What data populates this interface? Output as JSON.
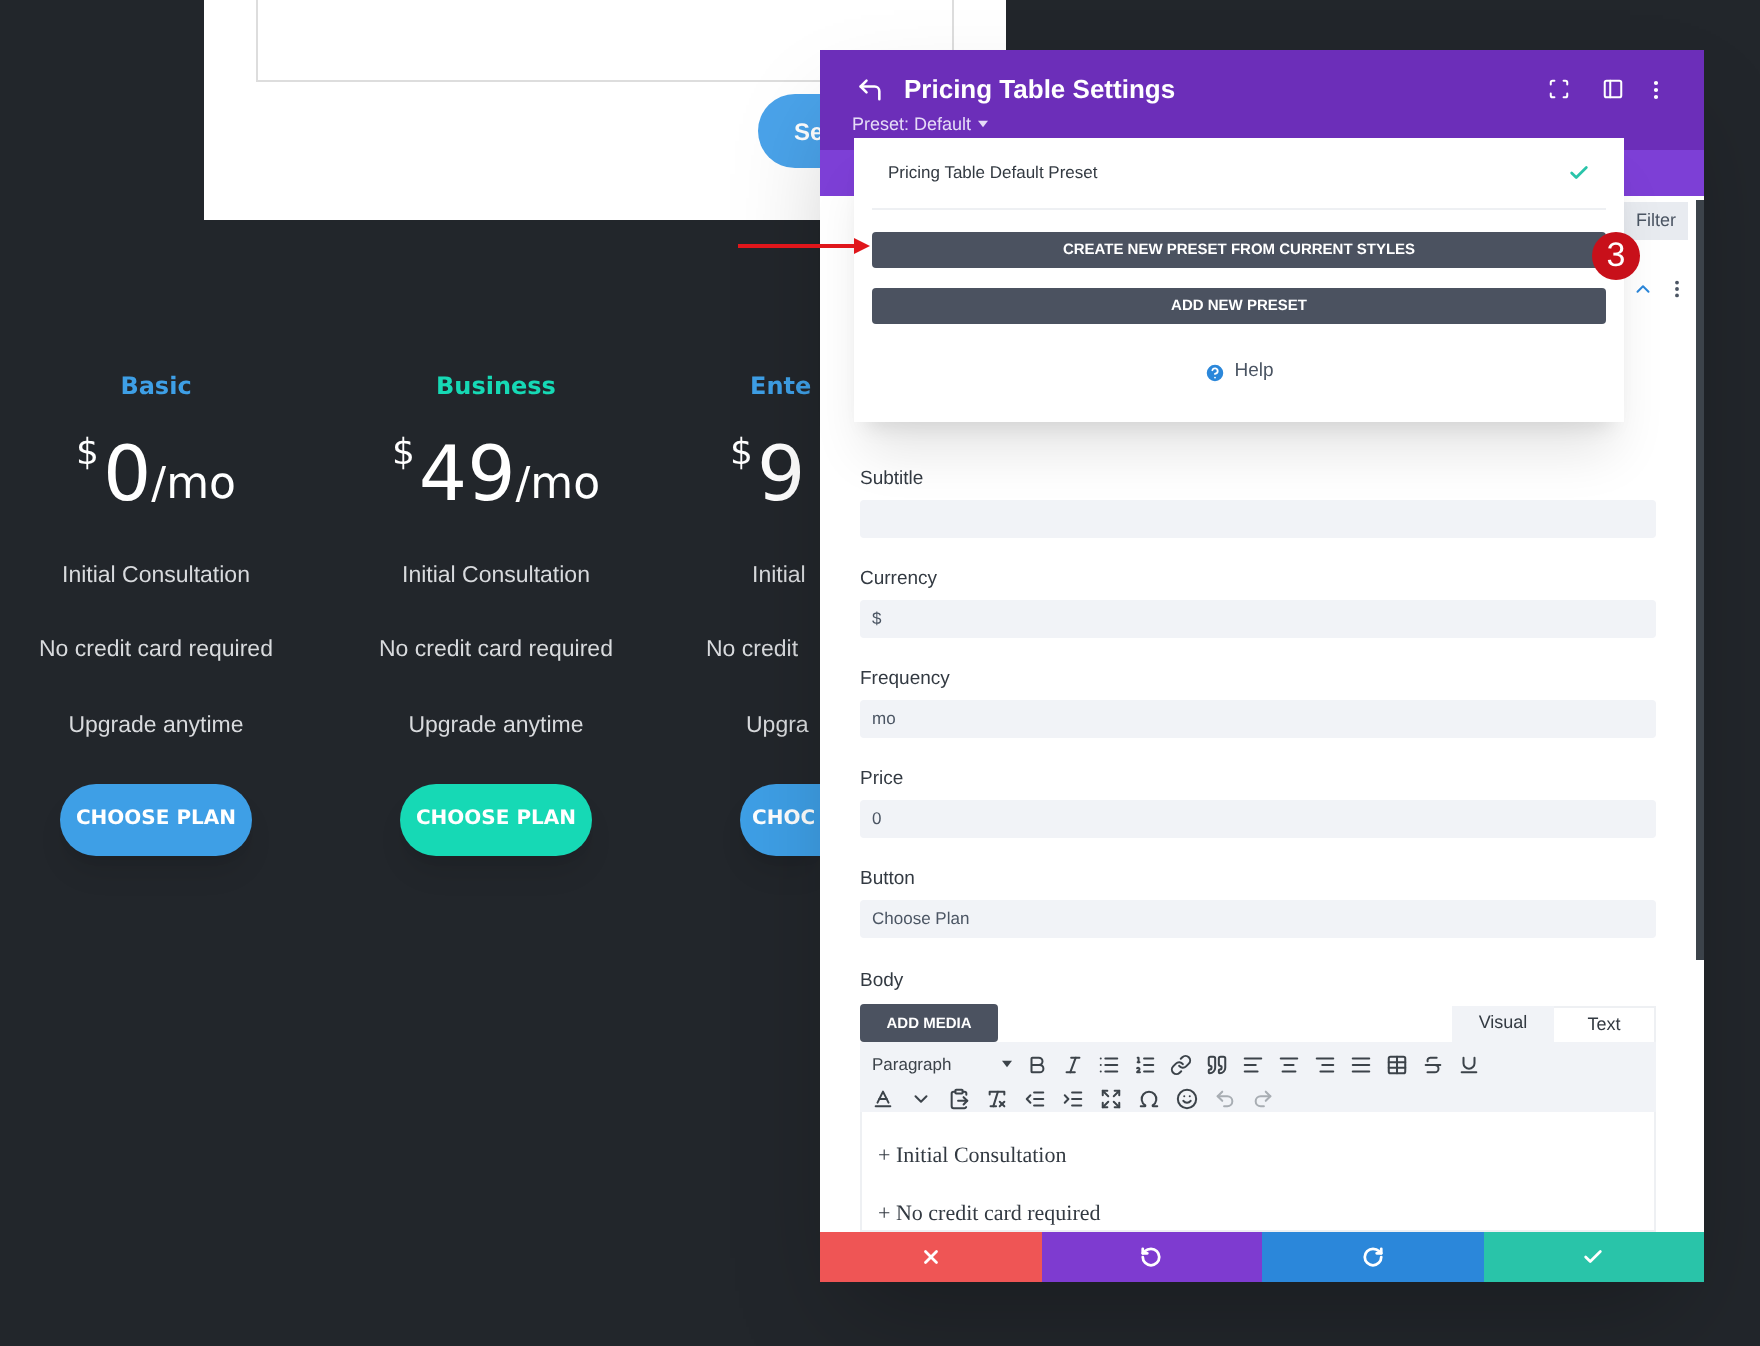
{
  "form_card": {
    "send_button": "Se"
  },
  "pricing_tables": [
    {
      "title": "Basic",
      "color": "#3e9fe6",
      "currency": "$",
      "price": "0",
      "frequency": "/mo",
      "features": [
        "Initial Consultation",
        "No credit card required",
        "Upgrade anytime"
      ],
      "button": "CHOOSE PLAN"
    },
    {
      "title": "Business",
      "color": "#16d9b5",
      "currency": "$",
      "price": "49",
      "frequency": "/mo",
      "features": [
        "Initial Consultation",
        "No credit card required",
        "Upgrade anytime"
      ],
      "button": "CHOOSE PLAN"
    },
    {
      "title": "Ente",
      "color": "#3e9fe6",
      "currency": "$",
      "price": "9",
      "features": [
        "Initial",
        "No credit",
        "Upgra"
      ],
      "button": "CHOC"
    }
  ],
  "modal": {
    "title": "Pricing Table Settings",
    "preset": "Preset: Default",
    "filter": "Filter",
    "preset_menu": {
      "presets": [
        {
          "name": "Pricing Table Default Preset",
          "selected": true
        }
      ],
      "buttons": [
        "CREATE NEW PRESET FROM CURRENT STYLES",
        "ADD NEW PRESET"
      ],
      "help": "Help"
    },
    "fields": [
      {
        "label": "Subtitle"
      },
      {
        "label": "Currency",
        "value": "$"
      },
      {
        "label": "Frequency",
        "value": "mo"
      },
      {
        "label": "Price",
        "value": "0"
      },
      {
        "label": "Button",
        "value": "Choose Plan"
      }
    ],
    "body": {
      "label": "Body",
      "add_media": "ADD MEDIA",
      "tabs": [
        {
          "label": "Visual",
          "selected": true
        },
        {
          "label": "Text",
          "selected": false
        }
      ],
      "format": "Paragraph",
      "lines": [
        "+ Initial Consultation",
        "+ No credit card required"
      ]
    },
    "actions": [
      {
        "kind": "cancel"
      },
      {
        "kind": "undo"
      },
      {
        "kind": "redo"
      },
      {
        "kind": "save"
      }
    ]
  },
  "annotation": {
    "number": "3"
  }
}
